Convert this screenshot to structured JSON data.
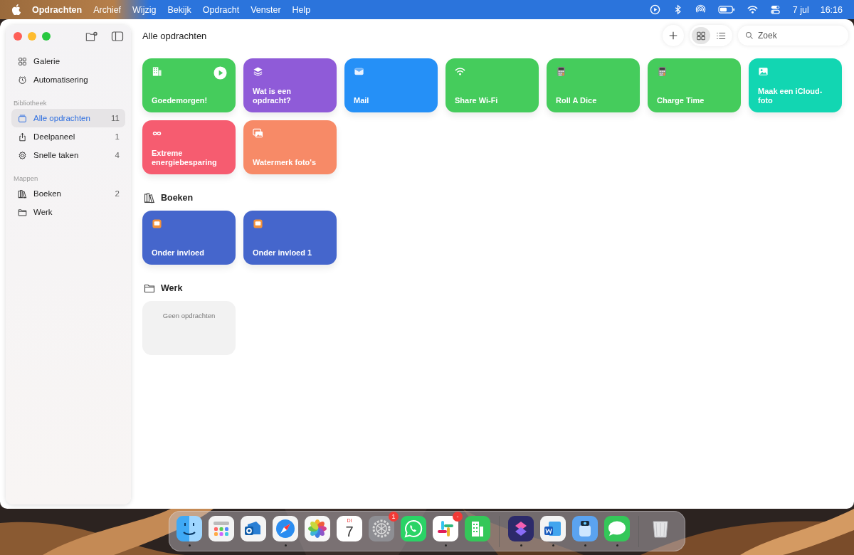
{
  "menubar": {
    "app": "Opdrachten",
    "menus": [
      "Archief",
      "Wijzig",
      "Bekijk",
      "Opdracht",
      "Venster",
      "Help"
    ],
    "date": "7 jul",
    "time": "16:16"
  },
  "sidebar": {
    "top_items": [
      {
        "label": "Galerie",
        "kind": "grid",
        "selected": false
      },
      {
        "label": "Automatisering",
        "kind": "clock",
        "selected": false
      }
    ],
    "sections": [
      {
        "title": "Bibliotheek",
        "items": [
          {
            "label": "Alle opdrachten",
            "kind": "stack",
            "count": "11",
            "selected": true
          },
          {
            "label": "Deelpaneel",
            "kind": "share",
            "count": "1",
            "selected": false
          },
          {
            "label": "Snelle taken",
            "kind": "gear",
            "count": "4",
            "selected": false
          }
        ]
      },
      {
        "title": "Mappen",
        "items": [
          {
            "label": "Boeken",
            "kind": "books",
            "count": "2",
            "selected": false
          },
          {
            "label": "Werk",
            "kind": "folder",
            "selected": false
          }
        ]
      }
    ]
  },
  "toolbar": {
    "title": "Alle opdrachten",
    "views": [
      {
        "kind": "grid",
        "selected": true
      },
      {
        "kind": "list",
        "selected": false
      }
    ],
    "search": {
      "placeholder": "Zoek"
    }
  },
  "shortcuts": [
    {
      "title": "Goedemorgen!",
      "kind": "building",
      "color": "#45cc5c",
      "play": true
    },
    {
      "title": "Wat is een opdracht?",
      "kind": "layers",
      "color": "#8f5bd8",
      "play": false
    },
    {
      "title": "Mail",
      "kind": "mail",
      "color": "#2590f7",
      "play": false
    },
    {
      "title": "Share Wi-Fi",
      "kind": "wifi",
      "color": "#45cc5c",
      "play": false
    },
    {
      "title": "Roll A Dice",
      "kind": "calculator",
      "color": "#45cc5c",
      "play": false
    },
    {
      "title": "Charge Time",
      "kind": "calculator",
      "color": "#45cc5c",
      "play": false
    },
    {
      "title": "Maak een iCloud-foto",
      "color": "#12d6b2",
      "play": false
    },
    {
      "title": "Extreme energiebesparing",
      "kind": "infinity",
      "color": "#f65c70",
      "play": false
    },
    {
      "title": "Watermerk foto's",
      "kind": "photos",
      "color": "#f78a67",
      "play": false
    }
  ],
  "folders": [
    {
      "name": "Boeken",
      "kind": "books",
      "shortcuts": [
        {
          "title": "Onder invloed",
          "kind": "book",
          "color": "#4566cc",
          "play": false
        },
        {
          "title": "Onder invloed 1",
          "kind": "book",
          "color": "#4566cc",
          "play": false
        }
      ]
    },
    {
      "name": "Werk",
      "kind": "folder",
      "empty_text": "Geen opdrachten"
    }
  ],
  "dock": [
    {
      "kind": "finder",
      "running": true
    },
    {
      "kind": "launchpad",
      "running": false
    },
    {
      "kind": "outlook",
      "running": false
    },
    {
      "kind": "safari",
      "running": true
    },
    {
      "kind": "photos",
      "running": false
    },
    {
      "kind": "calendar",
      "weekday": "DI",
      "day": "7",
      "running": false
    },
    {
      "kind": "settings",
      "badge": "1",
      "running": false
    },
    {
      "kind": "whatsapp",
      "running": false
    },
    {
      "kind": "slack",
      "badge": "-",
      "running": true
    },
    {
      "kind": "numbers",
      "running": false
    },
    {
      "kind": "separator"
    },
    {
      "kind": "shortcuts",
      "running": true
    },
    {
      "kind": "word",
      "running": true
    },
    {
      "kind": "preview",
      "running": true
    },
    {
      "kind": "messages",
      "running": true
    },
    {
      "kind": "separator"
    },
    {
      "kind": "trash",
      "running": false
    }
  ]
}
